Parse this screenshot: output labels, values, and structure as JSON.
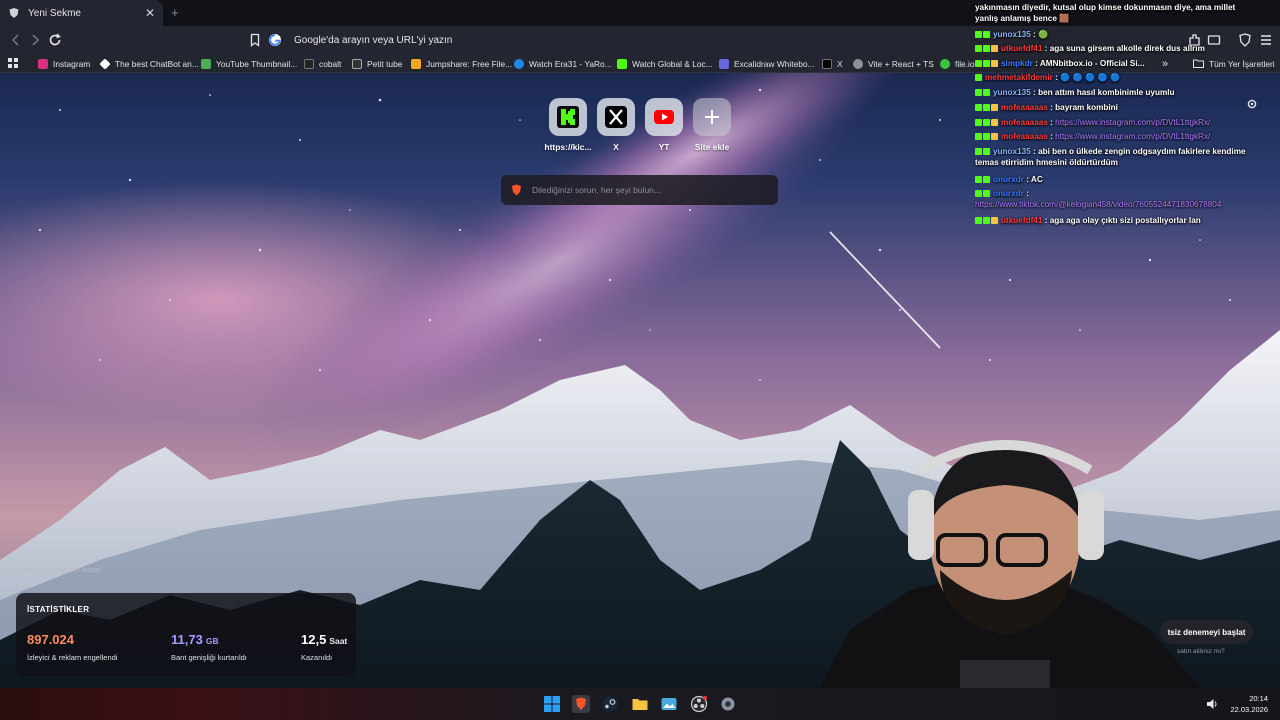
{
  "browser": {
    "tab_title": "Yeni Sekme",
    "tab_close": "✕",
    "new_tab": "+",
    "omnibox_placeholder": "Google'da arayın veya URL'yi yazın",
    "bookmarks": [
      {
        "label": "Instagram",
        "color": "#d6317f"
      },
      {
        "label": "The best ChatBot an...",
        "color": "#ffffff"
      },
      {
        "label": "YouTube Thumbnail...",
        "color": "#4caf50"
      },
      {
        "label": "cobalt",
        "color": "#222222"
      },
      {
        "label": "Petit tube",
        "color": "#333333"
      },
      {
        "label": "Jumpshare: Free File...",
        "color": "#f4a623"
      },
      {
        "label": "Watch Era31 - YaRo...",
        "color": "#1e88e5"
      },
      {
        "label": "Watch Global & Loc...",
        "color": "#53fc18"
      },
      {
        "label": "Excalidraw Whitebo...",
        "color": "#6965db"
      },
      {
        "label": "X",
        "color": "#000000"
      },
      {
        "label": "Vite + React + TS",
        "color": "#8f8f96"
      },
      {
        "label": "file.io",
        "color": "#3ec33e"
      }
    ],
    "bookmarks_more": "»",
    "all_bookmarks": "Tüm Yer İşaretleri"
  },
  "newtab": {
    "tiles": [
      {
        "label": "https://kic...",
        "icon": "kick-icon"
      },
      {
        "label": "X",
        "icon": "x-icon"
      },
      {
        "label": "YT",
        "icon": "youtube-icon"
      },
      {
        "label": "Site ekle",
        "icon": "plus-icon"
      }
    ],
    "search_placeholder": "Dilediğinizi sorun, her şeyi bulun...",
    "photo_credit": "Fotoğraf: Benjamin Voros",
    "stats": {
      "title": "İSTATİSTİKLER",
      "items": [
        {
          "value": "897.024",
          "unit": "",
          "label": "İzleyici & reklam engellendi",
          "color": "#ff8a5c"
        },
        {
          "value": "11,73",
          "unit": "GB",
          "label": "Bant genişliği kurtarıldı",
          "color": "#a79cff"
        },
        {
          "value": "12,5",
          "unit": "Saat",
          "label": "Kazanıldı",
          "color": "#ffffff"
        }
      ]
    },
    "trial_button": "tsiz denemeyi başlat",
    "trial_link": "satın aldınız mı?"
  },
  "chat": {
    "messages": [
      {
        "user": "",
        "user_color": "#ffffff",
        "text": "yakınmasın diyedir, kutsal olup kimse dokunmasın diye, ama millet yanlış anlamış bence 🟫",
        "badges": []
      },
      {
        "user": "yunox135",
        "user_color": "#8ab4ff",
        "text": "🟢",
        "badges": [
          "#53fc18",
          "#53fc18"
        ]
      },
      {
        "user": "utkuefdf41",
        "user_color": "#ff3b3b",
        "text": "aga suna girsem alkolle direk dus allrım",
        "badges": [
          "#53fc18",
          "#53fc18",
          "#f5c542"
        ]
      },
      {
        "user": "simpkdr",
        "user_color": "#3e7bff",
        "text": "AMNbitbox.io - Official Si...",
        "badges": [
          "#53fc18",
          "#53fc18",
          "#f5c542"
        ]
      },
      {
        "user": "mehmetakifdemir",
        "user_color": "#ff3b3b",
        "text": "🔵 🔵 🔵 🔵 🔵",
        "badges": [
          "#53fc18"
        ]
      },
      {
        "user": "yunox135",
        "user_color": "#8ab4ff",
        "text": "ben attım hasıl kombinimle uyumlu",
        "badges": [
          "#53fc18",
          "#53fc18"
        ]
      },
      {
        "user": "mofeaaaaas",
        "user_color": "#ff3b3b",
        "text": "bayram kombini",
        "badges": [
          "#53fc18",
          "#53fc18",
          "#f5c542"
        ]
      },
      {
        "user": "mofeaaaaas",
        "user_color": "#ff3b3b",
        "text": "https://www.instagram.com/p/DVtL1ttgkRx/",
        "badges": [
          "#53fc18",
          "#53fc18",
          "#f5c542"
        ]
      },
      {
        "user": "mofeaaaaas",
        "user_color": "#ff3b3b",
        "text": "https://www.instagram.com/p/DVtL1ttgkRx/",
        "badges": [
          "#53fc18",
          "#53fc18",
          "#f5c542"
        ]
      },
      {
        "user": "yunox135",
        "user_color": "#8ab4ff",
        "text": "abi ben o ülkede zengin odgsaydım fakirlere kendime temas etirridim hmesini öldürtürdüm",
        "badges": [
          "#53fc18",
          "#53fc18"
        ]
      },
      {
        "user": "onurxdr",
        "user_color": "#3e7bff",
        "text": "AC",
        "badges": [
          "#53fc18",
          "#53fc18"
        ]
      },
      {
        "user": "onurxdr",
        "user_color": "#3e7bff",
        "text": "https://www.tiktok.com/@kelogian458/video/7605524471830678804",
        "badges": [
          "#53fc18",
          "#53fc18"
        ]
      },
      {
        "user": "utkuefdf41",
        "user_color": "#ff3b3b",
        "text": "aga aga olay çıktı sizi postallıyorlar lan",
        "badges": [
          "#53fc18",
          "#53fc18",
          "#f5c542"
        ]
      }
    ]
  },
  "taskbar": {
    "time": "20:14",
    "date": "22.03.2026"
  }
}
